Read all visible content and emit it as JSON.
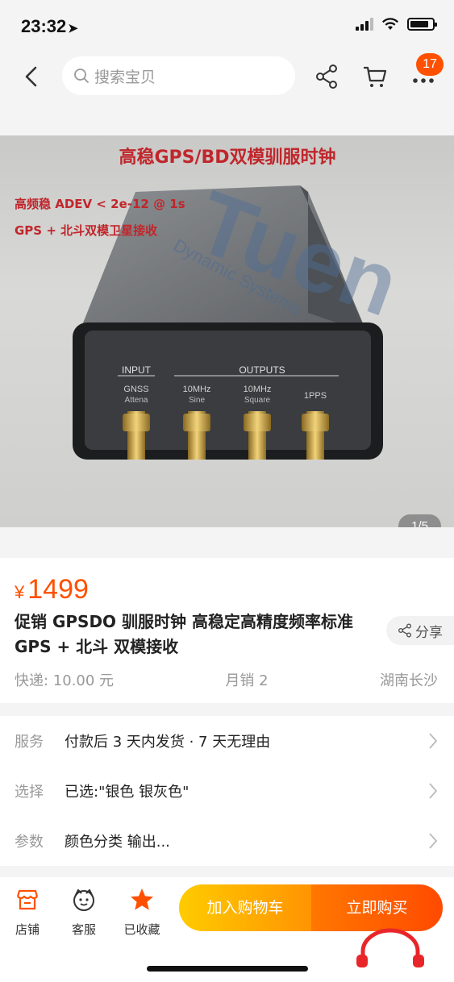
{
  "status_bar": {
    "time": "23:32",
    "location_arrow": "➤"
  },
  "nav": {
    "search_placeholder": "搜索宝贝",
    "cart_badge": "17",
    "icons": [
      "back-icon",
      "search-icon",
      "share-icon",
      "cart-icon",
      "more-icon"
    ]
  },
  "gallery": {
    "image_headline": "高稳GPS/BD双模驯服时钟",
    "image_line1": "高频稳 ADEV < 2e-12 @ 1s",
    "image_line2": "GPS + 北斗双模卫星接收",
    "watermark": "Tuen",
    "watermark_sub": "Dynamic Systems",
    "panel_input": "INPUT",
    "panel_outputs": "OUTPUTS",
    "ports": [
      {
        "name": "GNSS",
        "sub": "Attena"
      },
      {
        "name": "10MHz",
        "sub": "Sine"
      },
      {
        "name": "10MHz",
        "sub": "Square"
      },
      {
        "name": "1PPS",
        "sub": ""
      }
    ],
    "page_indicator": "1/5"
  },
  "product": {
    "currency": "¥",
    "price": "1499",
    "title": "促销 GPSDO 驯服时钟 高稳定高精度频率标准 GPS + 北斗 双模接收",
    "share_label": "分享",
    "shipping": "快递: 10.00 元",
    "monthly_sales": "月销 2",
    "location": "湖南长沙"
  },
  "services": [
    {
      "key": "服务",
      "value": "付款后 3 天内发货 · 7 天无理由"
    },
    {
      "key": "选择",
      "value": "已选:\"银色 银灰色\""
    },
    {
      "key": "参数",
      "value": "颜色分类 输出..."
    }
  ],
  "bottom_bar": {
    "tabs": [
      {
        "label": "店铺",
        "icon": "store-icon"
      },
      {
        "label": "客服",
        "icon": "customer-service-icon"
      },
      {
        "label": "已收藏",
        "icon": "star-icon"
      }
    ],
    "add_to_cart": "加入购物车",
    "buy_now": "立即购买"
  },
  "colors": {
    "accent": "#ff5000",
    "cart_gradient": [
      "#ffcb00",
      "#ff9402"
    ],
    "buy_gradient": [
      "#ff7700",
      "#ff4a00"
    ]
  }
}
